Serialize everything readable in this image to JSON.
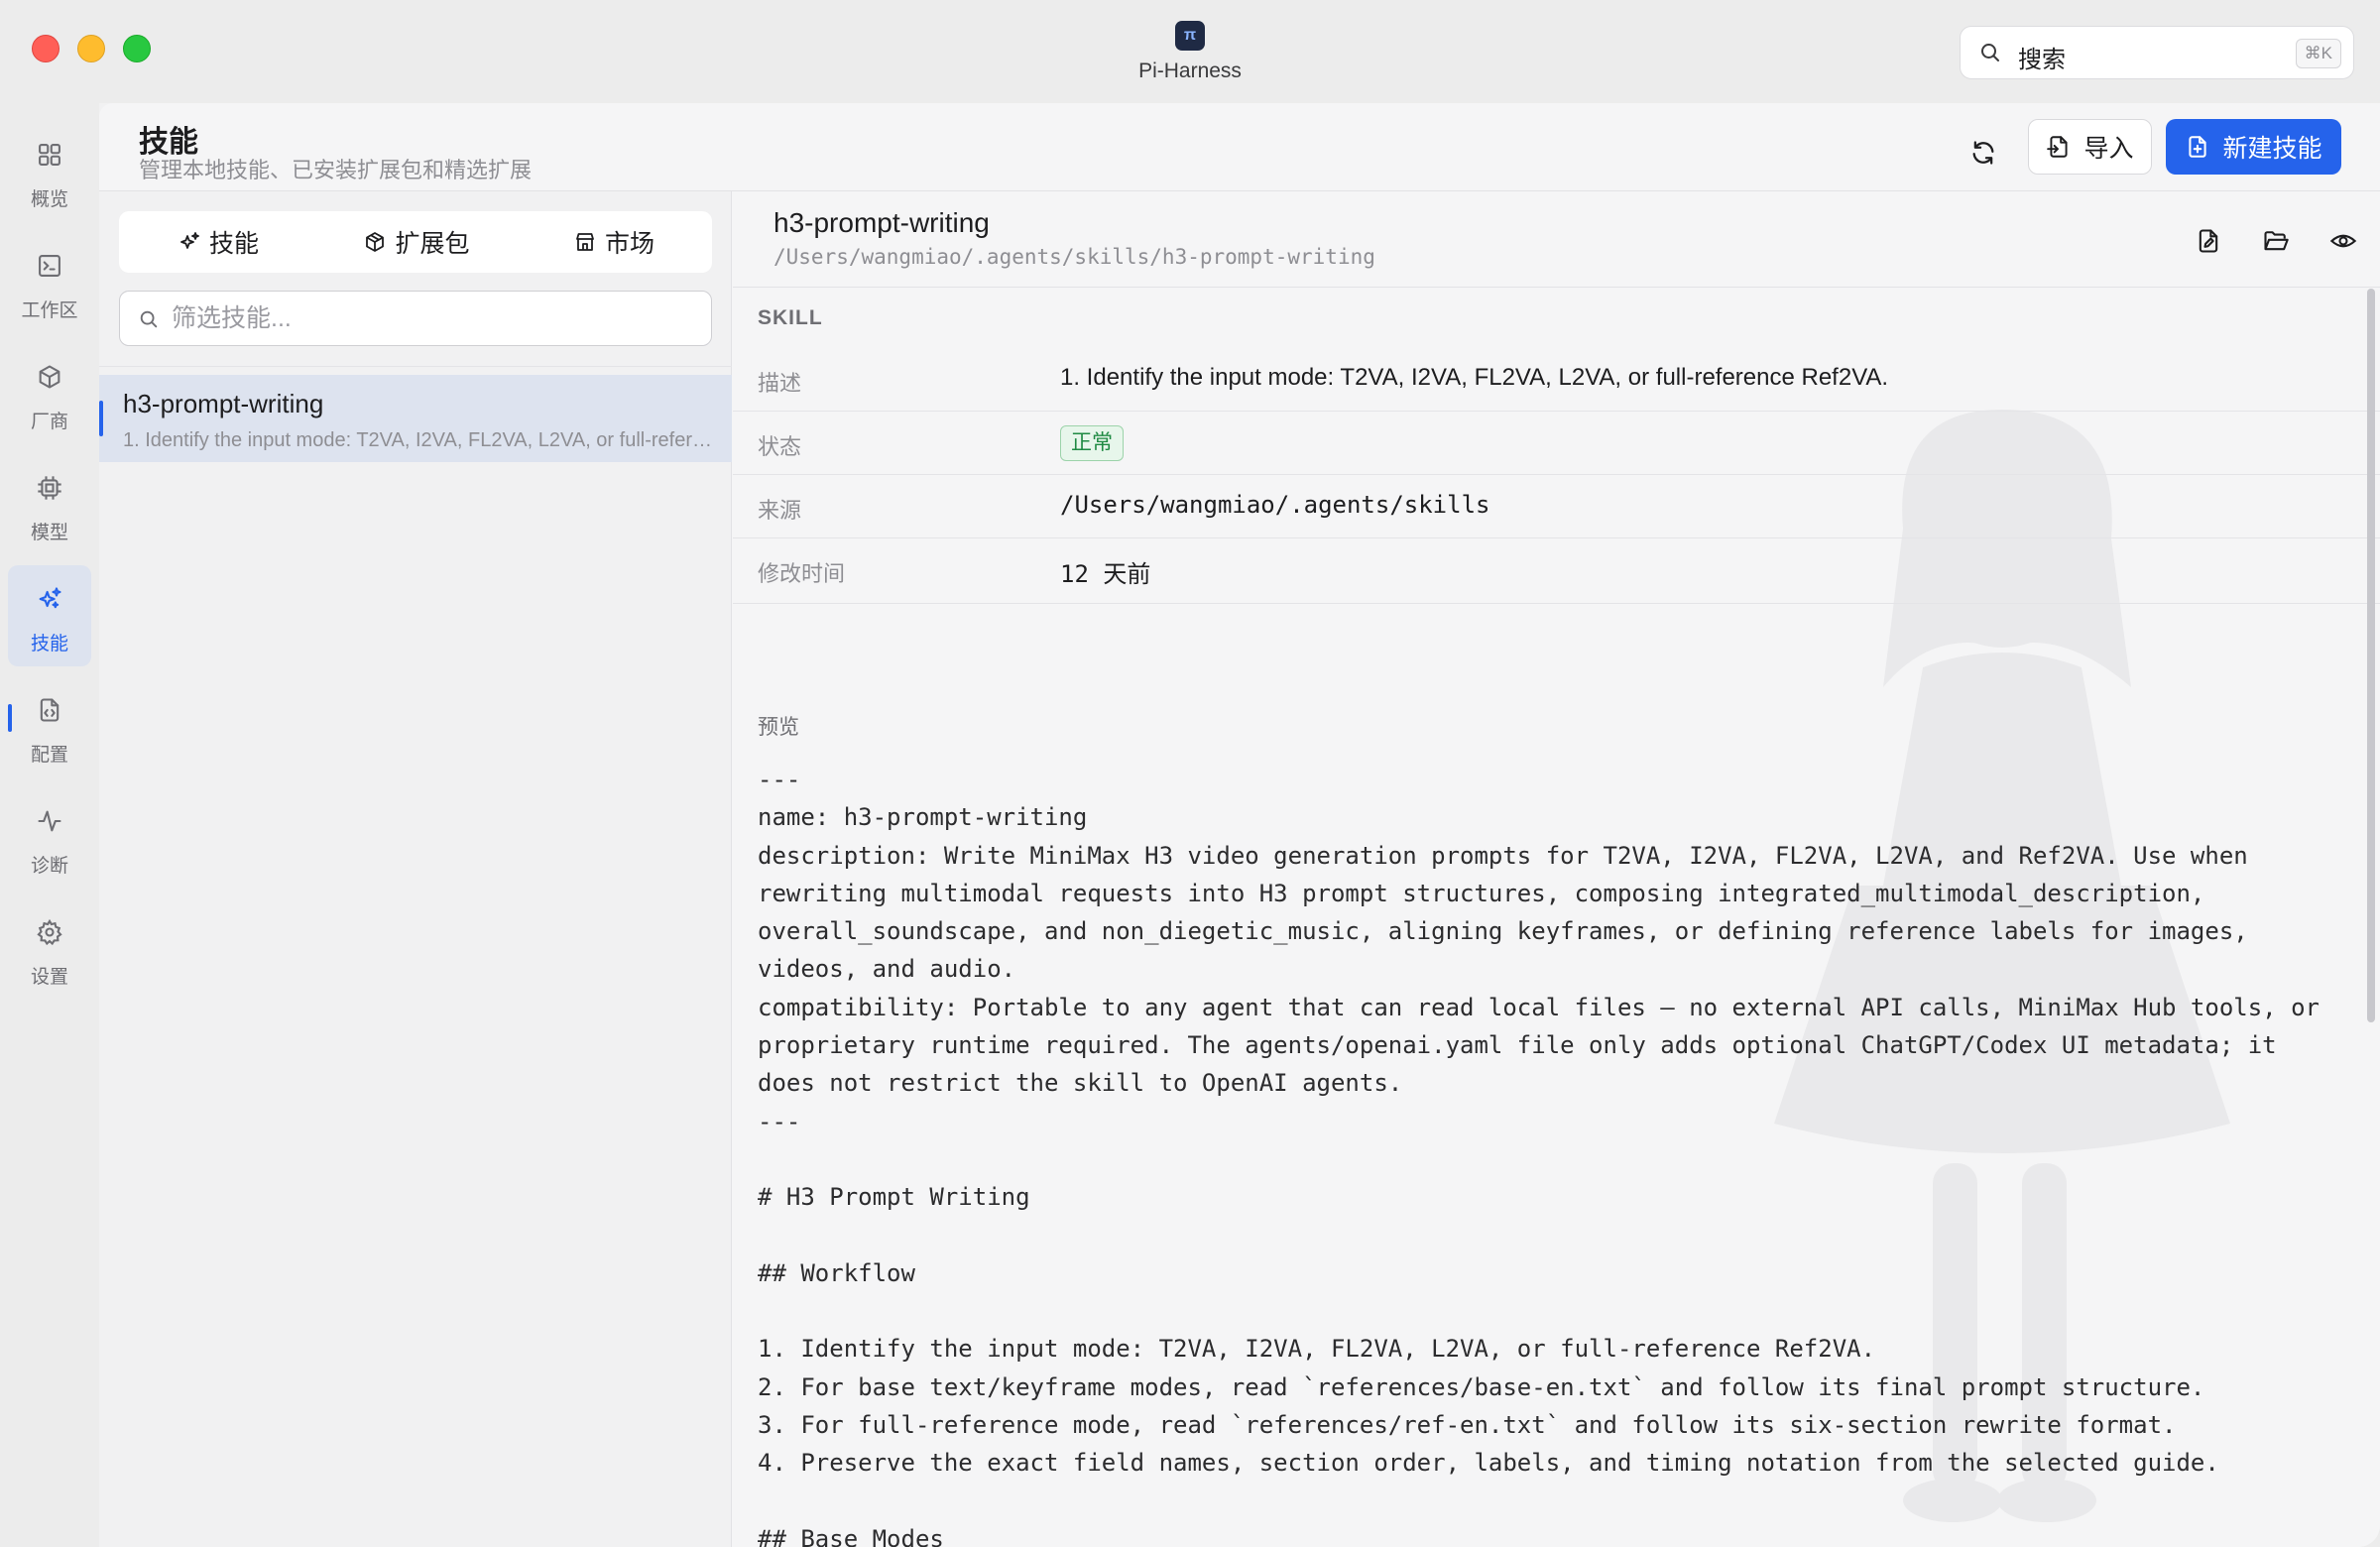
{
  "window": {
    "app_title": "Pi-Harness",
    "search": {
      "label": "搜索",
      "shortcut": "⌘K"
    }
  },
  "sidebar": {
    "items": [
      {
        "label": "概览",
        "icon": "grid-icon"
      },
      {
        "label": "工作区",
        "icon": "terminal-icon"
      },
      {
        "label": "厂商",
        "icon": "cube-icon"
      },
      {
        "label": "模型",
        "icon": "chip-icon"
      },
      {
        "label": "技能",
        "icon": "sparkles-icon",
        "active": true
      },
      {
        "label": "配置",
        "icon": "file-code-icon"
      },
      {
        "label": "诊断",
        "icon": "activity-icon"
      },
      {
        "label": "设置",
        "icon": "gear-icon"
      }
    ]
  },
  "header": {
    "title": "技能",
    "subtitle": "管理本地技能、已安装扩展包和精选扩展",
    "import_label": "导入",
    "new_label": "新建技能"
  },
  "list": {
    "tabs": [
      {
        "label": "技能",
        "icon": "sparkles-icon"
      },
      {
        "label": "扩展包",
        "icon": "package-icon"
      },
      {
        "label": "市场",
        "icon": "store-icon"
      }
    ],
    "filter_placeholder": "筛选技能...",
    "items": [
      {
        "name": "h3-prompt-writing",
        "description": "1. Identify the input mode: T2VA, I2VA, FL2VA, L2VA, or full-reference Ref2VA."
      }
    ]
  },
  "detail": {
    "name": "h3-prompt-writing",
    "path": "/Users/wangmiao/.agents/skills/h3-prompt-writing",
    "section": "SKILL",
    "fields": {
      "description_key": "描述",
      "description_value": "1. Identify the input mode: T2VA, I2VA, FL2VA, L2VA, or full-reference Ref2VA.",
      "status_key": "状态",
      "status_value": "正常",
      "source_key": "来源",
      "source_value": "/Users/wangmiao/.agents/skills",
      "modified_key": "修改时间",
      "modified_value": "12 天前"
    },
    "preview_label": "预览",
    "preview_text": "---\nname: h3-prompt-writing\ndescription: Write MiniMax H3 video generation prompts for T2VA, I2VA, FL2VA, L2VA, and Ref2VA. Use when rewriting multimodal requests into H3 prompt structures, composing integrated_multimodal_description, overall_soundscape, and non_diegetic_music, aligning keyframes, or defining reference labels for images, videos, and audio.\ncompatibility: Portable to any agent that can read local files — no external API calls, MiniMax Hub tools, or proprietary runtime required. The agents/openai.yaml file only adds optional ChatGPT/Codex UI metadata; it does not restrict the skill to OpenAI agents.\n---\n\n# H3 Prompt Writing\n\n## Workflow\n\n1. Identify the input mode: T2VA, I2VA, FL2VA, L2VA, or full-reference Ref2VA.\n2. For base text/keyframe modes, read `references/base-en.txt` and follow its final prompt structure.\n3. For full-reference mode, read `references/ref-en.txt` and follow its six-section rewrite format.\n4. Preserve the exact field names, section order, labels, and timing notation from the selected guide.\n\n## Base Modes"
  },
  "colors": {
    "accent": "#2563eb",
    "status_green": "#1f8a43",
    "close": "#ff5f57",
    "minimize": "#febc2e",
    "maximize": "#28c840"
  }
}
